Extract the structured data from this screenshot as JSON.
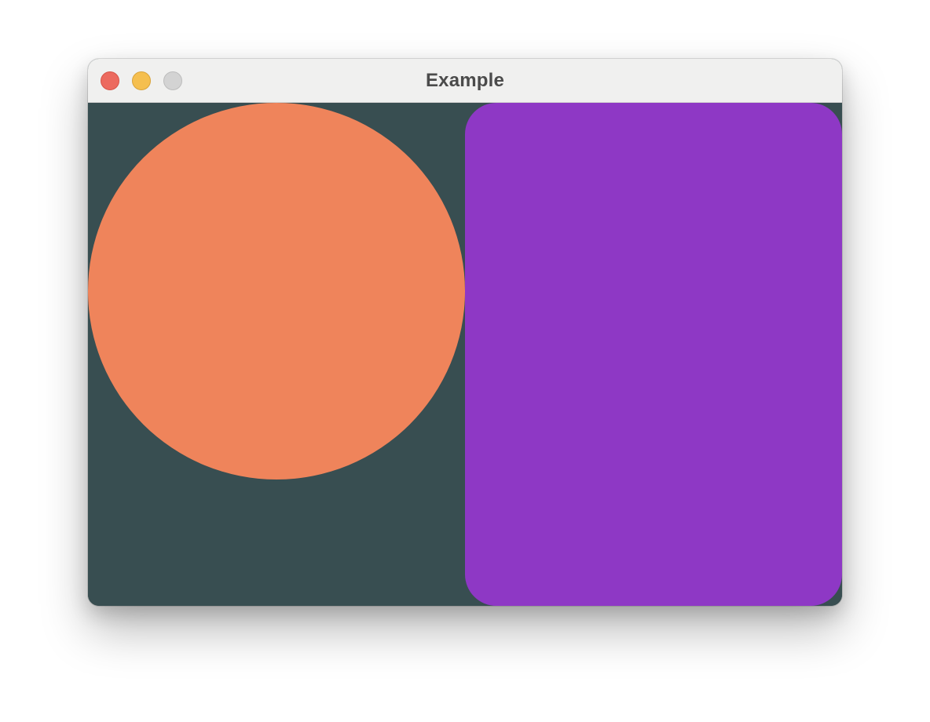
{
  "window": {
    "title": "Example",
    "controls": {
      "close_color": "#ec6a5f",
      "close_border": "#d65448",
      "minimize_color": "#f5bf4f",
      "minimize_border": "#d9a33a",
      "zoom_color": "#d3d3d3",
      "zoom_border": "#bcbcbc"
    }
  },
  "canvas": {
    "background": "#384e51",
    "shapes": [
      {
        "kind": "circle",
        "color": "#ef845b"
      },
      {
        "kind": "rounded-rectangle",
        "color": "#8e38c5"
      }
    ]
  }
}
